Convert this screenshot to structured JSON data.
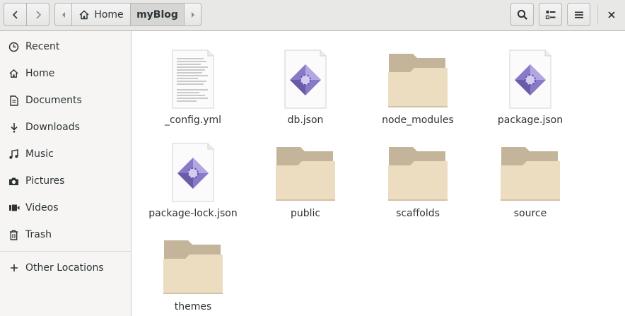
{
  "breadcrumb": {
    "home_label": "Home",
    "current_label": "myBlog"
  },
  "sidebar": {
    "places": [
      {
        "label": "Recent",
        "icon": "clock-icon"
      },
      {
        "label": "Home",
        "icon": "home-icon"
      },
      {
        "label": "Documents",
        "icon": "document-icon"
      },
      {
        "label": "Downloads",
        "icon": "download-icon"
      },
      {
        "label": "Music",
        "icon": "music-icon"
      },
      {
        "label": "Pictures",
        "icon": "camera-icon"
      },
      {
        "label": "Videos",
        "icon": "video-icon"
      },
      {
        "label": "Trash",
        "icon": "trash-icon"
      }
    ],
    "other_locations": {
      "label": "Other Locations",
      "icon": "plus-icon"
    }
  },
  "files": [
    {
      "name": "_config.yml",
      "type": "text-file"
    },
    {
      "name": "db.json",
      "type": "code-file"
    },
    {
      "name": "node_modules",
      "type": "folder"
    },
    {
      "name": "package.json",
      "type": "code-file"
    },
    {
      "name": "package-lock.json",
      "type": "code-file"
    },
    {
      "name": "public",
      "type": "folder"
    },
    {
      "name": "scaffolds",
      "type": "folder"
    },
    {
      "name": "source",
      "type": "folder"
    },
    {
      "name": "themes",
      "type": "folder"
    }
  ],
  "colors": {
    "folder_back": "#c4b49a",
    "folder_front": "#ecdcc0",
    "accent_purple": "#8a78c8"
  }
}
